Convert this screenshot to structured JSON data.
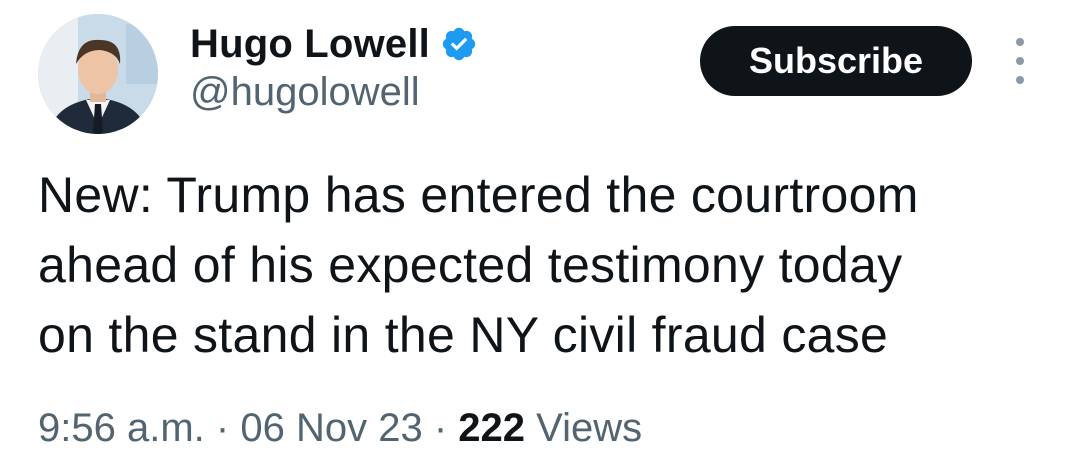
{
  "author": {
    "display_name": "Hugo Lowell",
    "handle": "@hugolowell",
    "verified_icon": "verified-badge-icon",
    "verified_color": "#1d9bf0"
  },
  "actions": {
    "subscribe_label": "Subscribe",
    "more_icon": "more-vertical-icon"
  },
  "tweet": {
    "lines": [
      "New: Trump has entered the courtroom",
      "ahead of his expected testimony today",
      "on the stand in the NY civil fraud case"
    ]
  },
  "meta": {
    "time": "9:56 a.m.",
    "separator": "·",
    "date": "06 Nov 23",
    "views_count": "222",
    "views_label": "Views"
  }
}
